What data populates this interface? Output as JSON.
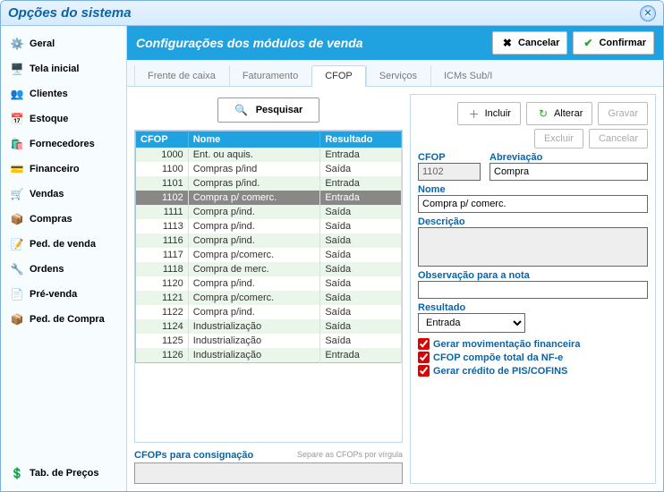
{
  "window": {
    "title": "Opções do sistema"
  },
  "sidebar": {
    "items": [
      {
        "label": "Geral",
        "icon": "⚙️"
      },
      {
        "label": "Tela inicial",
        "icon": "🖥️"
      },
      {
        "label": "Clientes",
        "icon": "👥"
      },
      {
        "label": "Estoque",
        "icon": "📅"
      },
      {
        "label": "Fornecedores",
        "icon": "🛍️"
      },
      {
        "label": "Financeiro",
        "icon": "💳"
      },
      {
        "label": "Vendas",
        "icon": "🛒"
      },
      {
        "label": "Compras",
        "icon": "📦"
      },
      {
        "label": "Ped. de venda",
        "icon": "📝"
      },
      {
        "label": "Ordens",
        "icon": "🔧"
      },
      {
        "label": "Pré-venda",
        "icon": "📄"
      },
      {
        "label": "Ped. de Compra",
        "icon": "📦"
      }
    ],
    "bottom": {
      "label": "Tab. de Preços",
      "icon": "💲"
    }
  },
  "header": {
    "title": "Configurações dos módulos de venda",
    "cancel": "Cancelar",
    "confirm": "Confirmar"
  },
  "tabs": [
    "Frente de caixa",
    "Faturamento",
    "CFOP",
    "Serviços",
    "ICMs Sub/I"
  ],
  "active_tab": 2,
  "search_label": "Pesquisar",
  "table": {
    "headers": [
      "CFOP",
      "Nome",
      "Resultado"
    ],
    "rows": [
      {
        "cfop": "1000",
        "nome": "Ent. ou aquis.",
        "res": "Entrada"
      },
      {
        "cfop": "1100",
        "nome": "Compras p/ind",
        "res": "Saída"
      },
      {
        "cfop": "1101",
        "nome": "Compras p/ind.",
        "res": "Entrada"
      },
      {
        "cfop": "1102",
        "nome": "Compra p/ comerc.",
        "res": "Entrada",
        "selected": true
      },
      {
        "cfop": "1111",
        "nome": "Compra p/ind.",
        "res": "Saída"
      },
      {
        "cfop": "1113",
        "nome": "Compra p/ind.",
        "res": "Saída"
      },
      {
        "cfop": "1116",
        "nome": "Compra p/ind.",
        "res": "Saída"
      },
      {
        "cfop": "1117",
        "nome": "Compra p/comerc.",
        "res": "Saída"
      },
      {
        "cfop": "1118",
        "nome": "Compra de merc.",
        "res": "Saída"
      },
      {
        "cfop": "1120",
        "nome": "Compra p/ind.",
        "res": "Saída"
      },
      {
        "cfop": "1121",
        "nome": "Compra p/comerc.",
        "res": "Saída"
      },
      {
        "cfop": "1122",
        "nome": "Compra p/ind.",
        "res": "Saída"
      },
      {
        "cfop": "1124",
        "nome": "Industrialização",
        "res": "Saída"
      },
      {
        "cfop": "1125",
        "nome": "Industrialização",
        "res": "Saída"
      },
      {
        "cfop": "1126",
        "nome": "Industrialização",
        "res": "Entrada"
      }
    ]
  },
  "consig": {
    "label": "CFOPs para consignação",
    "hint": "Separe as CFOPs por vírgula",
    "value": ""
  },
  "toolbar": {
    "incluir": "Incluir",
    "alterar": "Alterar",
    "gravar": "Gravar",
    "excluir": "Excluir",
    "cancelar": "Cancelar"
  },
  "form": {
    "cfop_label": "CFOP",
    "cfop": "1102",
    "abrev_label": "Abreviação",
    "abrev": "Compra",
    "nome_label": "Nome",
    "nome": "Compra p/ comerc.",
    "desc_label": "Descrição",
    "desc": "",
    "obs_label": "Observação para a nota",
    "obs": "",
    "res_label": "Resultado",
    "res": "Entrada",
    "check1": "Gerar movimentação financeira",
    "check2": "CFOP compõe total da NF-e",
    "check3": "Gerar crédito de PIS/COFINS"
  }
}
